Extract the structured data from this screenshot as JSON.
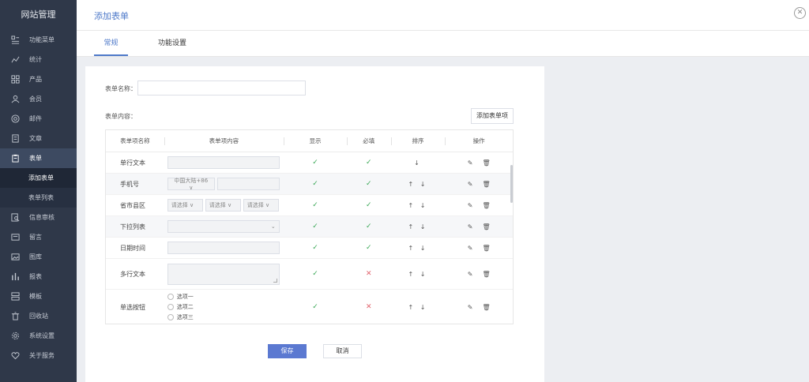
{
  "sidebar": {
    "brand": "网站管理",
    "items": [
      {
        "label": "功能菜单",
        "icon": "menu-icon"
      },
      {
        "label": "统计",
        "icon": "chart-icon"
      },
      {
        "label": "产品",
        "icon": "grid-icon"
      },
      {
        "label": "会员",
        "icon": "user-icon"
      },
      {
        "label": "邮件",
        "icon": "mail-icon"
      },
      {
        "label": "文章",
        "icon": "document-icon"
      },
      {
        "label": "表单",
        "icon": "form-icon",
        "active": true
      },
      {
        "label": "信息审核",
        "icon": "search-doc-icon"
      },
      {
        "label": "留言",
        "icon": "message-icon"
      },
      {
        "label": "图库",
        "icon": "image-icon"
      },
      {
        "label": "报表",
        "icon": "bar-chart-icon"
      },
      {
        "label": "模板",
        "icon": "template-icon"
      },
      {
        "label": "回收站",
        "icon": "trash-icon"
      },
      {
        "label": "系统设置",
        "icon": "settings-icon"
      },
      {
        "label": "关于服务",
        "icon": "heart-icon"
      }
    ],
    "subitems": [
      {
        "label": "添加表单",
        "active": true
      },
      {
        "label": "表单列表"
      }
    ]
  },
  "header": {
    "title": "添加表单"
  },
  "tabs": [
    {
      "label": "常规"
    },
    {
      "label": "功能设置"
    }
  ],
  "form": {
    "name_label": "表单名称：",
    "name_value": "",
    "content_label": "表单内容：",
    "add_field_label": "添加表单项"
  },
  "table": {
    "headers": [
      "表单项名称",
      "表单项内容",
      "显示",
      "必填",
      "排序",
      "操作"
    ],
    "rows": [
      {
        "name": "单行文本",
        "kind": "input",
        "show": "check",
        "required": "check",
        "sort": "↓"
      },
      {
        "name": "手机号",
        "kind": "phone",
        "prefix": "中国大陆+86 ∨",
        "show": "check",
        "required": "check",
        "sort": "↑ ↓"
      },
      {
        "name": "省市县区",
        "kind": "selects",
        "selects": [
          "请选择 ∨",
          "请选择 ∨",
          "请选择 ∨"
        ],
        "show": "check",
        "required": "check",
        "sort": "↑ ↓"
      },
      {
        "name": "下拉列表",
        "kind": "dropdown",
        "show": "check",
        "required": "check",
        "sort": "↑ ↓"
      },
      {
        "name": "日期时间",
        "kind": "input",
        "show": "check",
        "required": "check",
        "sort": "↑ ↓"
      },
      {
        "name": "多行文本",
        "kind": "textarea",
        "show": "check",
        "required": "cross",
        "sort": "↑ ↓"
      },
      {
        "name": "单选按钮",
        "kind": "radios",
        "options": [
          "选项一",
          "选项二",
          "选项三"
        ],
        "show": "check",
        "required": "cross",
        "sort": "↑ ↓"
      }
    ],
    "check_symbol": "✓",
    "cross_symbol": "✕",
    "edit_symbol": "✎",
    "delete_symbol": "🗑"
  },
  "buttons": {
    "save": "保存",
    "cancel": "取消"
  },
  "colors": {
    "sidebar_bg": "#2f3849",
    "accent": "#4e79c9",
    "primary_button": "#5b79d1",
    "check": "#3aa756",
    "cross": "#e0606a"
  }
}
